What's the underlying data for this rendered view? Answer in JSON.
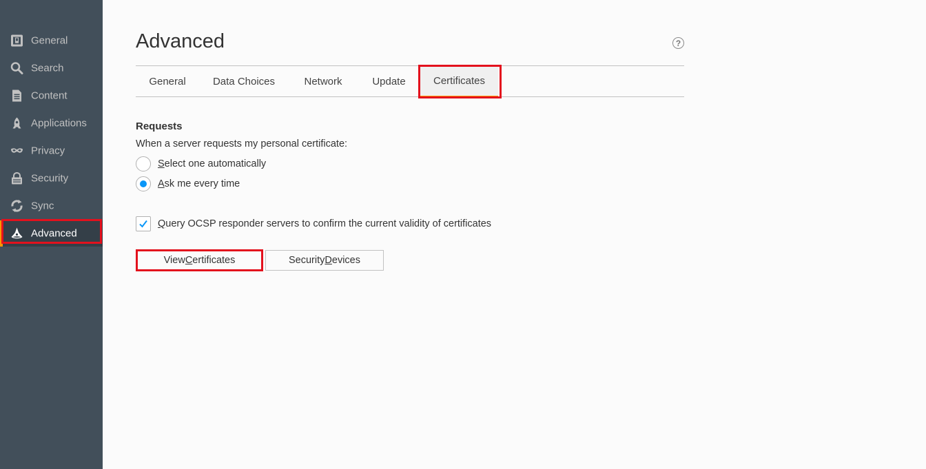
{
  "sidebar": {
    "items": [
      {
        "label": "General",
        "icon": "general-icon"
      },
      {
        "label": "Search",
        "icon": "search-icon"
      },
      {
        "label": "Content",
        "icon": "content-icon"
      },
      {
        "label": "Applications",
        "icon": "applications-icon"
      },
      {
        "label": "Privacy",
        "icon": "privacy-mask-icon"
      },
      {
        "label": "Security",
        "icon": "security-lock-icon"
      },
      {
        "label": "Sync",
        "icon": "sync-icon"
      },
      {
        "label": "Advanced",
        "icon": "advanced-wizard-hat-icon",
        "selected": true
      }
    ]
  },
  "page": {
    "title": "Advanced",
    "help_icon": "?"
  },
  "tabs": [
    {
      "label": "General"
    },
    {
      "label": "Data Choices"
    },
    {
      "label": "Network"
    },
    {
      "label": "Update"
    },
    {
      "label": "Certificates",
      "selected": true
    }
  ],
  "requests": {
    "title": "Requests",
    "description": "When a server requests my personal certificate:",
    "options": [
      {
        "accesskey": "S",
        "rest": "elect one automatically",
        "checked": false
      },
      {
        "accesskey": "A",
        "rest": "sk me every time",
        "checked": true
      }
    ]
  },
  "ocsp": {
    "accesskey": "Q",
    "rest": "uery OCSP responder servers to confirm the current validity of certificates",
    "checked": true
  },
  "buttons": {
    "view_pre": "View ",
    "view_key": "C",
    "view_post": "ertificates",
    "devices_pre": "Security ",
    "devices_key": "D",
    "devices_post": "evices"
  },
  "colors": {
    "sidebar_bg": "#424f5a",
    "accent_orange": "#ff9500",
    "highlight_red": "#e3111d",
    "radio_blue": "#0996f8"
  }
}
